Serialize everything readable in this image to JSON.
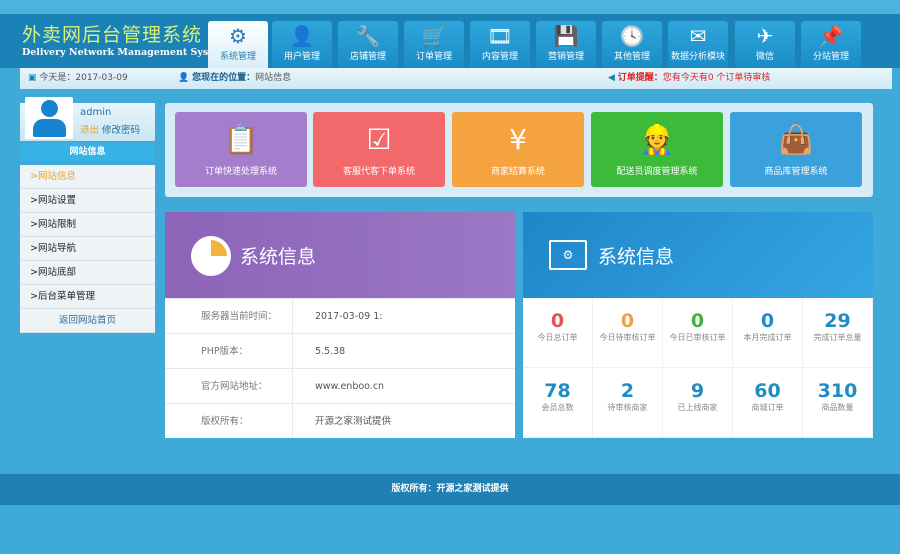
{
  "header": {
    "title_cn": "外卖网后台管理系统",
    "title_en": "Delivery Network Management System"
  },
  "tabs": [
    {
      "label": "系统管理",
      "icon": "⚙"
    },
    {
      "label": "用户管理",
      "icon": "👤"
    },
    {
      "label": "店铺管理",
      "icon": "🔧"
    },
    {
      "label": "订单管理",
      "icon": "🛒"
    },
    {
      "label": "内容管理",
      "icon": "🎞"
    },
    {
      "label": "营销管理",
      "icon": "💾"
    },
    {
      "label": "其他管理",
      "icon": "🕓"
    },
    {
      "label": "数据分析模块",
      "icon": "✉"
    },
    {
      "label": "微信",
      "icon": "✈"
    },
    {
      "label": "分站管理",
      "icon": "📌"
    }
  ],
  "crumb": {
    "date_label": "今天是：2017-03-09",
    "location_label": "您现在的位置：",
    "location": "网站信息",
    "notice_label": "订单提醒：",
    "notice": "您有今天有0 个订单待审核"
  },
  "user": {
    "name": "admin",
    "logout": "退出",
    "change_pw": "修改密码"
  },
  "sidebar": {
    "heading": "网站信息",
    "items": [
      ">网站信息",
      ">网站设置",
      ">网站限制",
      ">网站导航",
      ">网站底部",
      ">后台菜单管理"
    ],
    "back": "返回网站首页"
  },
  "tiles": [
    {
      "label": "订单快速处理系统",
      "icon": "📋",
      "color": "#a47dcc"
    },
    {
      "label": "客服代客下单系统",
      "icon": "☑",
      "color": "#f2686b"
    },
    {
      "label": "商家结算系统",
      "icon": "¥",
      "color": "#f5a33e"
    },
    {
      "label": "配送员调度管理系统",
      "icon": "👷",
      "color": "#3dba3a"
    },
    {
      "label": "商品库管理系统",
      "icon": "👜",
      "color": "#3ba1dd"
    }
  ],
  "sysinfo": {
    "title": "系统信息",
    "rows": [
      {
        "k": "服务器当前时间：",
        "v": "2017-03-09 1:"
      },
      {
        "k": "PHP版本：",
        "v": "5.5.38"
      },
      {
        "k": "官方网站地址：",
        "v": "www.enboo.cn"
      },
      {
        "k": "版权所有：",
        "v": "开源之家测试提供"
      }
    ]
  },
  "stats": {
    "title": "系统信息",
    "items": [
      {
        "n": "0",
        "l": "今日总订单",
        "c": "#e0525a"
      },
      {
        "n": "0",
        "l": "今日待审核订单",
        "c": "#eba14a"
      },
      {
        "n": "0",
        "l": "今日已审核订单",
        "c": "#3fb53c"
      },
      {
        "n": "0",
        "l": "本月完成订单",
        "c": "#1f8dc3"
      },
      {
        "n": "29",
        "l": "完成订单总量",
        "c": "#1f8dc3"
      },
      {
        "n": "78",
        "l": "会员总数",
        "c": "#1f8dc3"
      },
      {
        "n": "2",
        "l": "待审核商家",
        "c": "#1f8dc3"
      },
      {
        "n": "9",
        "l": "已上线商家",
        "c": "#1f8dc3"
      },
      {
        "n": "60",
        "l": "商城订单",
        "c": "#1f8dc3"
      },
      {
        "n": "310",
        "l": "商品数量",
        "c": "#1f8dc3"
      }
    ]
  },
  "footer": "版权所有：开源之家测试提供"
}
